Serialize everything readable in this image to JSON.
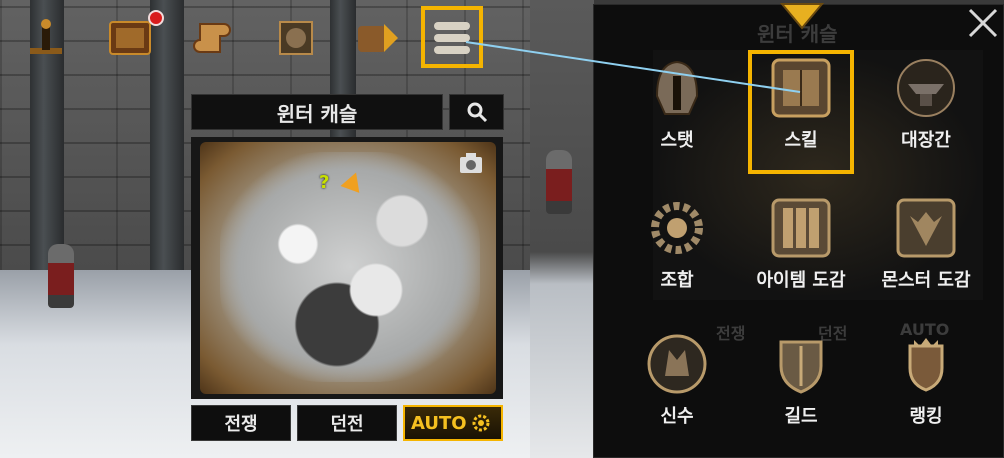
{
  "toolbar": {
    "icons": [
      {
        "name": "quest-icon"
      },
      {
        "name": "mail-icon",
        "has_badge": true
      },
      {
        "name": "scroll-icon"
      },
      {
        "name": "shield-icon"
      },
      {
        "name": "bag-icon"
      },
      {
        "name": "menu-icon",
        "highlighted": true
      }
    ]
  },
  "map": {
    "title": "윈터 캐슬",
    "marker_quest": "?",
    "buttons": {
      "war": "전쟁",
      "dungeon": "던전",
      "auto": "AUTO"
    }
  },
  "menu": {
    "ghost_title": "윈터 캐슬",
    "ghost_buttons": [
      "전쟁",
      "던전",
      "AUTO"
    ],
    "items": [
      {
        "label": "스탯",
        "icon": "helmet-icon"
      },
      {
        "label": "스킬",
        "icon": "skill-book-icon",
        "selected": true
      },
      {
        "label": "대장간",
        "icon": "anvil-icon"
      },
      {
        "label": "조합",
        "icon": "gear-combine-icon"
      },
      {
        "label": "아이템 도감",
        "icon": "item-codex-icon"
      },
      {
        "label": "몬스터 도감",
        "icon": "monster-codex-icon"
      },
      {
        "label": "신수",
        "icon": "wolf-icon"
      },
      {
        "label": "길드",
        "icon": "guild-shield-icon"
      },
      {
        "label": "랭킹",
        "icon": "ranking-crest-icon"
      }
    ]
  },
  "colors": {
    "highlight": "#f5b400",
    "connector": "#8fd0f0",
    "badge": "#d81c1c"
  }
}
